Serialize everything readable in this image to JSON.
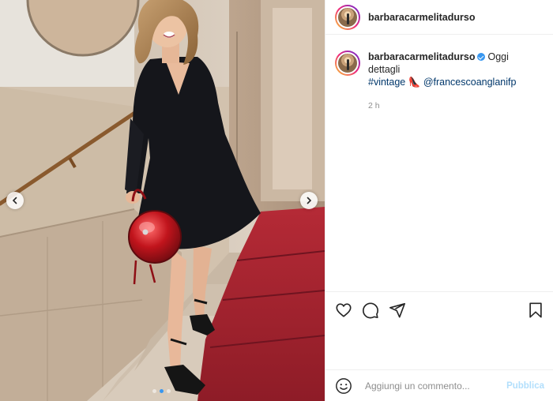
{
  "post": {
    "author": "barbaracarmelitadurso",
    "verified": true,
    "caption": {
      "text": "Oggi dettagli",
      "hashtag": "#vintage",
      "emoji": "👠",
      "mention": "@francescoanglanifp"
    },
    "timestamp": "2 h",
    "carousel": {
      "total_slides": 3,
      "active_slide": 2
    }
  },
  "actions": {
    "like_icon": "heart-icon",
    "comment_icon": "comment-icon",
    "share_icon": "paper-plane-icon",
    "save_icon": "bookmark-icon"
  },
  "comment_box": {
    "placeholder": "Aggiungi un commento...",
    "publish_label": "Pubblica",
    "emoji_icon": "smiley-icon"
  },
  "colors": {
    "accent": "#3897f0",
    "link": "#00376b",
    "muted": "#8e8e8e",
    "publish_disabled": "#b2dffc",
    "dress": "#15161b",
    "bag": "#b01c22",
    "carpet": "#a8242f"
  }
}
